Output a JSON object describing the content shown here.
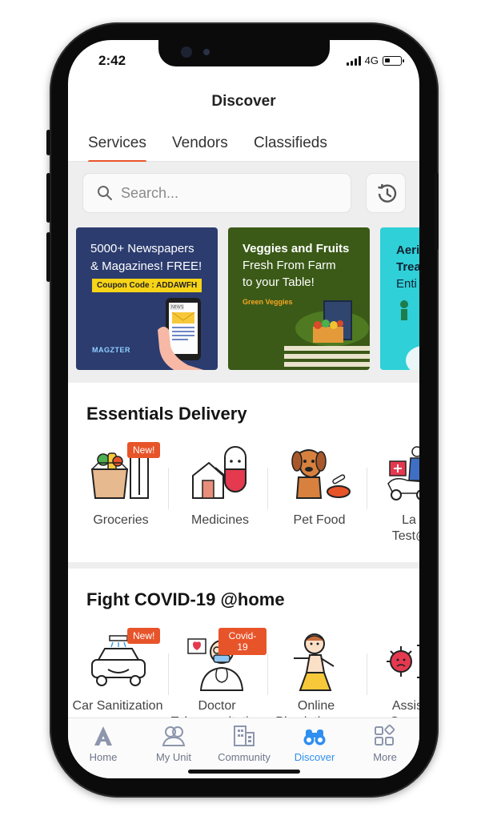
{
  "status": {
    "time": "2:42",
    "network": "4G"
  },
  "header": {
    "title": "Discover"
  },
  "tabs": [
    {
      "label": "Services",
      "active": true
    },
    {
      "label": "Vendors",
      "active": false
    },
    {
      "label": "Classifieds",
      "active": false
    }
  ],
  "search": {
    "placeholder": "Search..."
  },
  "banners": [
    {
      "line1": "5000+ Newspapers",
      "line2": "& Magazines! FREE!",
      "coupon": "Coupon Code : ADDAWFH",
      "brand": "MAGZTER",
      "tag": "NEWS"
    },
    {
      "line1": "Veggies and Fruits",
      "line2": "Fresh From Farm",
      "line3": "to your Table!",
      "brand": "Green Veggies"
    },
    {
      "line1": "Aeri",
      "line2": "Trea",
      "line3": "Enti"
    }
  ],
  "essentials": {
    "title": "Essentials Delivery",
    "items": [
      {
        "label": "Groceries",
        "badge": "New!"
      },
      {
        "label": "Medicines"
      },
      {
        "label": "Pet Food"
      },
      {
        "label": "La",
        "label2": "Test@h"
      }
    ]
  },
  "covid": {
    "title": "Fight COVID-19 @home",
    "items": [
      {
        "label": "Car Sanitization",
        "badge": "New!"
      },
      {
        "label": "Doctor",
        "label2": "Teleconsultation",
        "badge": "Covid-19"
      },
      {
        "label": "Online",
        "label2": "Physiotherapy"
      },
      {
        "label": "Assis",
        "label2": "Quara"
      }
    ]
  },
  "nav": [
    {
      "label": "Home"
    },
    {
      "label": "My Unit"
    },
    {
      "label": "Community"
    },
    {
      "label": "Discover",
      "active": true
    },
    {
      "label": "More"
    }
  ],
  "colors": {
    "accent": "#e8542a",
    "active_nav": "#2f8ff0",
    "magzter_bg": "#2c3c6f",
    "veggies_bg": "#3b5a17",
    "banner3_bg": "#2fd0d8"
  }
}
